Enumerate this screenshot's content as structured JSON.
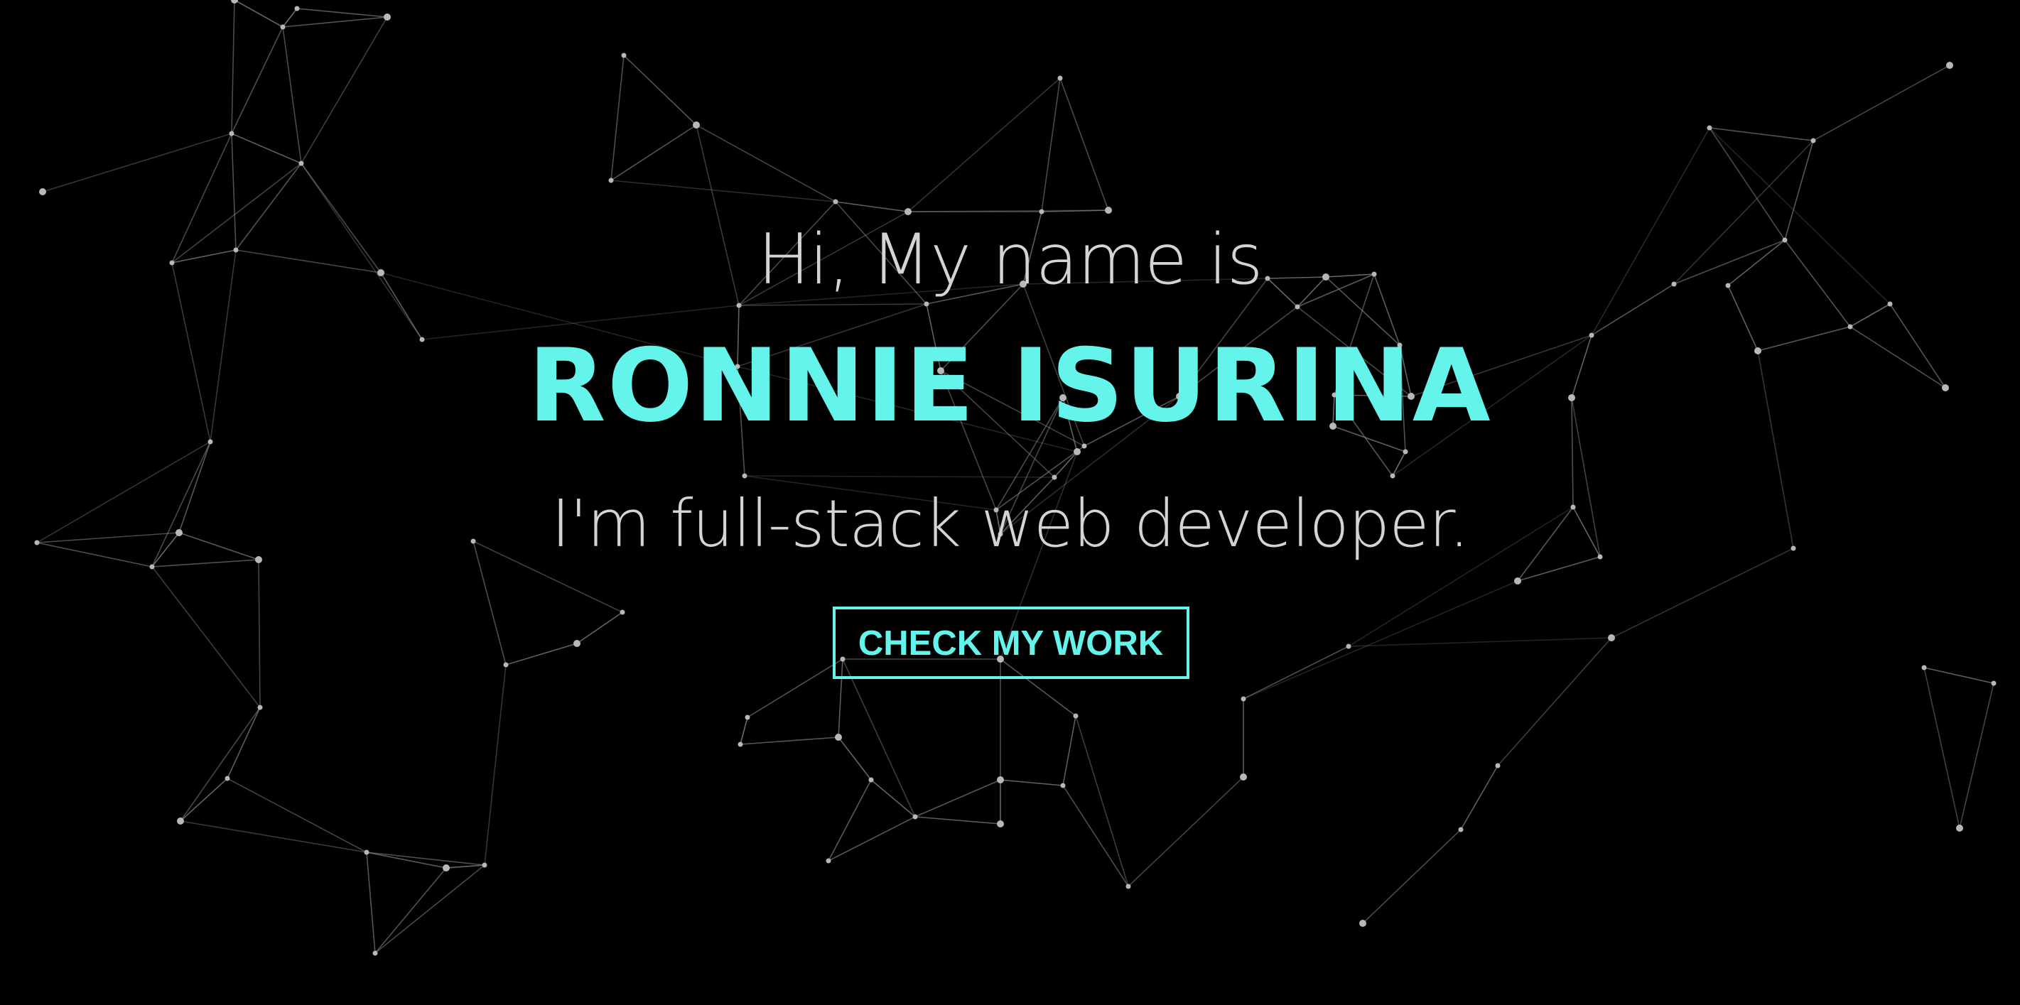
{
  "hero": {
    "greeting": "Hi, My name is",
    "name": "RONNIE ISURINA",
    "tagline": "I'm full-stack web developer.",
    "cta_label": "CHECK MY WORK"
  },
  "colors": {
    "background": "#000000",
    "accent": "#64f4ec",
    "text_light": "#d4d4d4",
    "network": "#8a8a8a"
  },
  "background_decoration": "particle-network"
}
